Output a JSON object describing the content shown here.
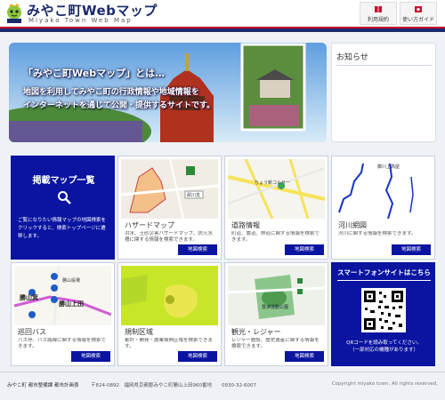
{
  "header": {
    "title": "みやこ町Webマップ",
    "subtitle": "Miyako Town Web Map",
    "terms_label": "利用規約",
    "guide_label": "使い方ガイド"
  },
  "hero": {
    "line1": "「みやこ町Webマップ」とは…",
    "line2": "地図を利用してみやこ町の行政情報や地域情報を",
    "line3": "インターネットを通じて公開・提供するサイトです。"
  },
  "news": {
    "title": "お知らせ"
  },
  "map_list": {
    "title": "掲載マップ一覧",
    "icon": "search-icon",
    "desc": "ご覧になりたい情報マップの地図検索をクリックすると、検索トップページに遷移します。"
  },
  "tiles": [
    {
      "name": "ハザードマップ",
      "desc": "洪水、土砂災害ハザードマップ、防火水槽に関する情報を検索できます。",
      "button": "地図検索"
    },
    {
      "name": "道路情報",
      "desc": "町道、農道、林道に関する情報を検索できます。",
      "button": "地図検索"
    },
    {
      "name": "河川網図",
      "desc": "河川に関する情報を検索できます。",
      "button": "地図検索"
    },
    {
      "name": "巡回バス",
      "desc": "バス停、バス路線に関する情報を検索できます。",
      "button": "地図検索"
    },
    {
      "name": "規制区域",
      "desc": "都計・開発・農業振興区域を検索できます。",
      "button": "地図検索"
    },
    {
      "name": "観光・レジャー",
      "desc": "レジャー施設、歴史遺産に関する情報を検索できます。",
      "button": "地図検索"
    }
  ],
  "smartphone": {
    "title": "スマートフォンサイトはこちら",
    "desc1": "QRコードを読み取ってください。",
    "desc2": "（一部対応の機種があります）"
  },
  "map_labels": {
    "hazard_label": "犀川支",
    "road_label": "ちょう新コルサー",
    "river_label": "脚川上高屋",
    "bus_label1": "勝山箕",
    "bus_label2": "勝山上田",
    "bus_label3": "勝山役場",
    "park_label": "豊津運動公園"
  },
  "footer": {
    "org": "みやこ町 都市整備課 都市計画係",
    "address": "〒824-0892　福岡県京都郡みやこ町勝山上田960番地　　0930-32-6007",
    "copyright": "Copyright miyako town. All rights reserved."
  },
  "colors": {
    "navy": "#1b2a6b",
    "tile_blue": "#0a14a0",
    "accent_red": "#c8102e"
  }
}
